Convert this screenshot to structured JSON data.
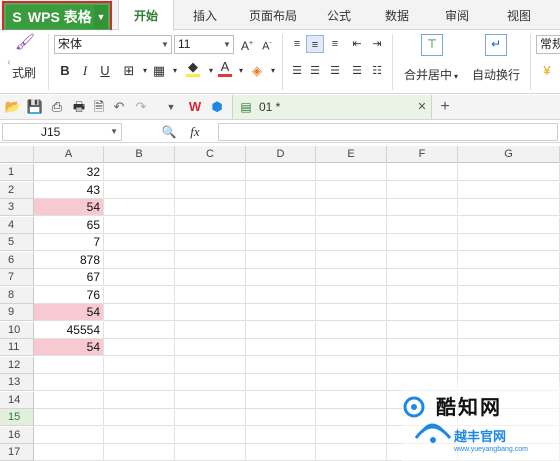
{
  "app": {
    "name": "WPS 表格",
    "logo_glyph": "S"
  },
  "menu": {
    "tabs": [
      "开始",
      "插入",
      "页面布局",
      "公式",
      "数据",
      "审阅",
      "视图"
    ],
    "active_index": 0
  },
  "ribbon": {
    "format_painter_label": "式刷",
    "font_name": "宋体",
    "font_size": "11",
    "merge_center_label": "合并居中",
    "wrap_text_label": "自动换行",
    "number_format_label": "常规",
    "bold": "B",
    "italic": "I",
    "underline": "U"
  },
  "doc_tab": {
    "name": "01 *"
  },
  "formula_bar": {
    "cell_ref": "J15",
    "fx_label": "fx",
    "value": ""
  },
  "grid": {
    "columns": [
      "A",
      "B",
      "C",
      "D",
      "E",
      "F",
      "G"
    ],
    "rows": [
      "1",
      "2",
      "3",
      "4",
      "5",
      "6",
      "7",
      "8",
      "9",
      "10",
      "11",
      "12",
      "13",
      "14",
      "15",
      "16",
      "17"
    ],
    "selected_row": "15",
    "colA_values": [
      "32",
      "43",
      "54",
      "65",
      "7",
      "878",
      "67",
      "76",
      "54",
      "45554",
      "54",
      "",
      "",
      "",
      "",
      "",
      ""
    ],
    "highlighted_rows": [
      "3",
      "9",
      "11"
    ]
  },
  "colors": {
    "brand_green": "#3a9c3e",
    "highlight_pink": "#f7c9d0",
    "annotation_red": "#d9262f",
    "watermark_blue": "#1e88e5"
  },
  "watermark": {
    "title": "酷知网",
    "site_cn": "越丰官网",
    "site_en": "www.yueyangbang.com"
  }
}
